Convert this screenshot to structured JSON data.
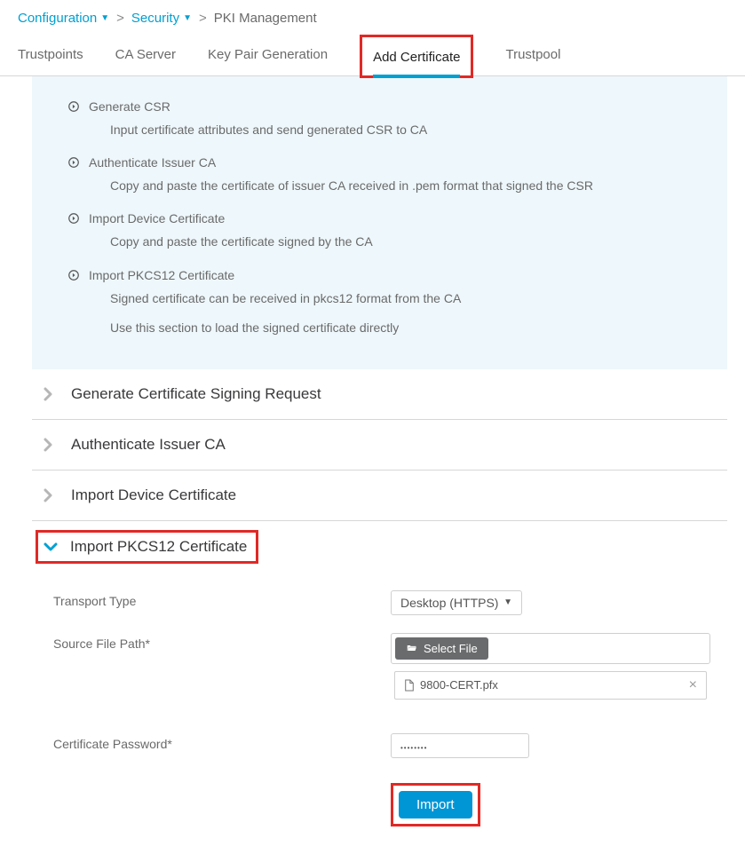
{
  "breadcrumb": {
    "item1": "Configuration",
    "item2": "Security",
    "current": "PKI Management",
    "sep": ">"
  },
  "tabs": {
    "t0": "Trustpoints",
    "t1": "CA Server",
    "t2": "Key Pair Generation",
    "t3": "Add Certificate",
    "t4": "Trustpool"
  },
  "info": {
    "i0": {
      "title": "Generate CSR",
      "desc": "Input certificate attributes and send generated CSR to CA"
    },
    "i1": {
      "title": "Authenticate Issuer CA",
      "desc": "Copy and paste the certificate of issuer CA received in .pem format that signed the CSR"
    },
    "i2": {
      "title": "Import Device Certificate",
      "desc": "Copy and paste the certificate signed by the CA"
    },
    "i3": {
      "title": "Import PKCS12 Certificate",
      "desc1": "Signed certificate can be received in pkcs12 format from the CA",
      "desc2": "Use this section to load the signed certificate directly"
    }
  },
  "sections": {
    "s0": "Generate Certificate Signing Request",
    "s1": "Authenticate Issuer CA",
    "s2": "Import Device Certificate",
    "s3": "Import PKCS12 Certificate"
  },
  "form": {
    "transport_label": "Transport Type",
    "transport_value": "Desktop (HTTPS)",
    "source_label": "Source File Path*",
    "select_file_label": "Select File",
    "file_name": "9800-CERT.pfx",
    "password_label": "Certificate Password*",
    "password_value": "••••••••",
    "import_label": "Import"
  }
}
